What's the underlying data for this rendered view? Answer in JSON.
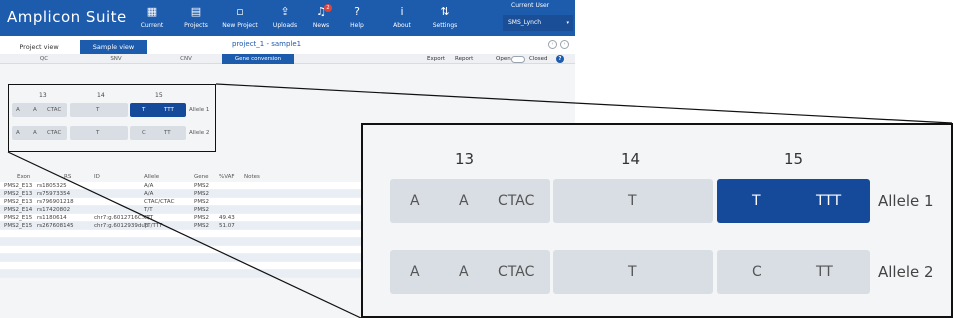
{
  "app": {
    "title": "Amplicon Suite"
  },
  "nav": [
    {
      "icon": "grid-icon",
      "glyph": "▦",
      "label": "Current"
    },
    {
      "icon": "projects-icon",
      "glyph": "▤",
      "label": "Projects"
    },
    {
      "icon": "new-project-icon",
      "glyph": "▫",
      "label": "New Project"
    },
    {
      "icon": "uploads-icon",
      "glyph": "⇪",
      "label": "Uploads"
    },
    {
      "icon": "bell-icon",
      "glyph": "♫",
      "label": "News",
      "badge": "2"
    },
    {
      "icon": "help-icon",
      "glyph": "?",
      "label": "Help"
    },
    {
      "icon": "info-icon",
      "glyph": "i",
      "label": "About"
    },
    {
      "icon": "settings-icon",
      "glyph": "⇅",
      "label": "Settings"
    }
  ],
  "user": {
    "label": "Current User",
    "value": "SMS_Lynch"
  },
  "views": {
    "project": "Project view",
    "sample": "Sample view"
  },
  "project_title": "project_1 - sample1",
  "sections": {
    "qc": "QC",
    "snv": "SNV",
    "cnv": "CNV",
    "gene_conversion": "Gene conversion"
  },
  "toolbar": {
    "export": "Export",
    "report": "Report",
    "open": "Open",
    "closed": "Closed",
    "help": "?"
  },
  "gene_conversion": {
    "positions": [
      "13",
      "14",
      "15"
    ],
    "alleles": [
      {
        "name": "Allele 1",
        "p13": [
          "A",
          "A",
          "CTAC"
        ],
        "p14": "T",
        "p15": [
          "T",
          "TTT"
        ],
        "selected": "p15"
      },
      {
        "name": "Allele 2",
        "p13": [
          "A",
          "A",
          "CTAC"
        ],
        "p14": "T",
        "p15": [
          "C",
          "TT"
        ],
        "selected": ""
      }
    ]
  },
  "table": {
    "columns": [
      "Exon",
      "RS",
      "ID",
      "Allele",
      "Gene",
      "%VAF",
      "Notes"
    ],
    "rows": [
      [
        "PMS2_E13",
        "rs1805325",
        "",
        "A/A",
        "PMS2",
        "",
        ""
      ],
      [
        "PMS2_E13",
        "rs75973354",
        "",
        "A/A",
        "PMS2",
        "",
        ""
      ],
      [
        "PMS2_E13",
        "rs796901218",
        "",
        "CTAC/CTAC",
        "PMS2",
        "",
        ""
      ],
      [
        "PMS2_E14",
        "rs17420802",
        "",
        "T/T",
        "PMS2",
        "",
        ""
      ],
      [
        "PMS2_E15",
        "rs1180614",
        "chr7:g.6012716C>T",
        "C/T",
        "PMS2",
        "49.43",
        ""
      ],
      [
        "PMS2_E15",
        "rs267608145",
        "chr7:g.6012939dup",
        "TT/TTT",
        "PMS2",
        "51.07",
        ""
      ]
    ],
    "empty_rows": 6
  },
  "colors": {
    "brand": "#1d5bad",
    "selected_cell": "#154a9a",
    "cell": "#d9dee5"
  }
}
